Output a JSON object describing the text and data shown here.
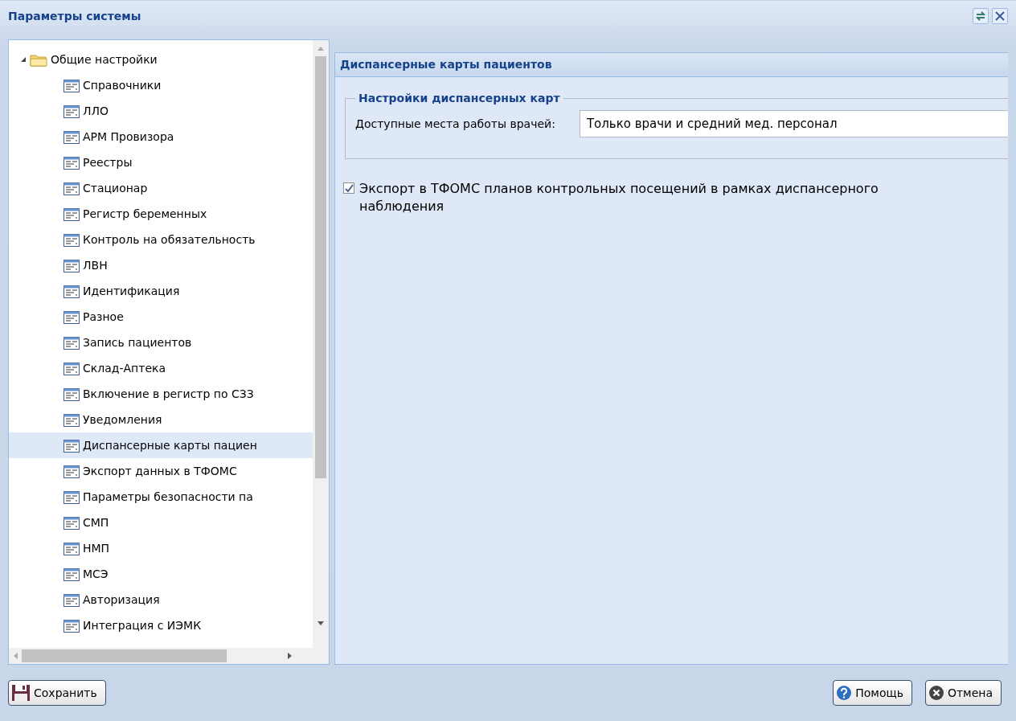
{
  "window": {
    "title": "Параметры системы"
  },
  "tree": {
    "label": "Общие настройки",
    "expanded": true,
    "children": [
      {
        "label": "Справочники",
        "selected": false
      },
      {
        "label": "ЛЛО",
        "selected": false
      },
      {
        "label": "АРМ Провизора",
        "selected": false
      },
      {
        "label": "Реестры",
        "selected": false
      },
      {
        "label": "Стационар",
        "selected": false
      },
      {
        "label": "Регистр беременных",
        "selected": false
      },
      {
        "label": "Контроль на обязательность",
        "selected": false
      },
      {
        "label": "ЛВН",
        "selected": false
      },
      {
        "label": "Идентификация",
        "selected": false
      },
      {
        "label": "Разное",
        "selected": false
      },
      {
        "label": "Запись пациентов",
        "selected": false
      },
      {
        "label": "Склад-Аптека",
        "selected": false
      },
      {
        "label": "Включение в регистр по СЗЗ",
        "selected": false
      },
      {
        "label": "Уведомления",
        "selected": false
      },
      {
        "label": "Диспансерные карты пациен",
        "selected": true
      },
      {
        "label": "Экспорт данных в ТФОМС",
        "selected": false
      },
      {
        "label": "Параметры безопасности па",
        "selected": false
      },
      {
        "label": "СМП",
        "selected": false
      },
      {
        "label": "НМП",
        "selected": false
      },
      {
        "label": "МСЭ",
        "selected": false
      },
      {
        "label": "Авторизация",
        "selected": false
      },
      {
        "label": "Интеграция с ИЭМК",
        "selected": false
      }
    ]
  },
  "panel": {
    "title": "Диспансерные карты пациентов",
    "fieldset": {
      "legend": "Настройки диспансерных карт",
      "field_label": "Доступные места работы врачей:",
      "field_value": "Только врачи и средний мед. персонал"
    },
    "checkbox": {
      "label": "Экспорт в ТФОМС планов контрольных посещений в рамках диспансерного наблюдения",
      "checked": true
    }
  },
  "buttons": [
    {
      "kind": "save",
      "label": "Сохранить"
    },
    {
      "kind": "help",
      "label": "Помощь"
    },
    {
      "kind": "cancel",
      "label": "Отмена"
    }
  ]
}
